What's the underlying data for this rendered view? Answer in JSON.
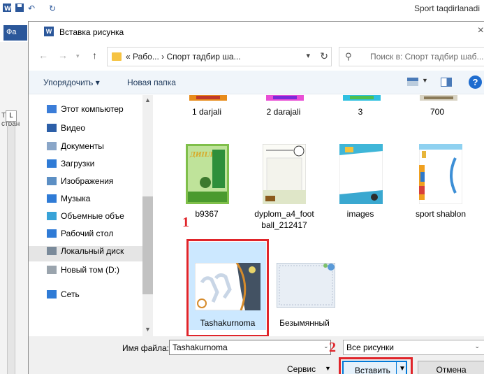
{
  "word": {
    "title": "Sport taqdirlanadi",
    "file_tab": "Фа",
    "left_label": "Титу стран",
    "ruler_btn": "L"
  },
  "dialog": {
    "title": "Вставка рисунка",
    "close": "×",
    "app_icon": "W"
  },
  "address": {
    "path": "« Рабо... › Спорт тадбир ша...",
    "search_placeholder": "Поиск в: Спорт тадбир шаб..."
  },
  "toolbar": {
    "organize": "Упорядочить ▾",
    "new_folder": "Новая папка",
    "help": "?"
  },
  "nav": {
    "items": [
      {
        "label": "Этот компьютер",
        "icon": "computer-icon",
        "color": "#3b7dd8"
      },
      {
        "label": "Видео",
        "icon": "video-icon",
        "color": "#2c5fa8"
      },
      {
        "label": "Документы",
        "icon": "documents-icon",
        "color": "#8aa6c8"
      },
      {
        "label": "Загрузки",
        "icon": "downloads-icon",
        "color": "#2f7bd6"
      },
      {
        "label": "Изображения",
        "icon": "pictures-icon",
        "color": "#5c8fc4"
      },
      {
        "label": "Музыка",
        "icon": "music-icon",
        "color": "#2f7bd6"
      },
      {
        "label": "Объемные объе",
        "icon": "3d-objects-icon",
        "color": "#38a3d8"
      },
      {
        "label": "Рабочий стол",
        "icon": "desktop-icon",
        "color": "#2f7bd6"
      },
      {
        "label": "Локальный диск",
        "icon": "local-disk-icon",
        "color": "#7a8a9a"
      },
      {
        "label": "Новый том (D:)",
        "icon": "drive-icon",
        "color": "#9aa4ad"
      },
      {
        "label": "Сеть",
        "icon": "network-icon",
        "color": "#2f7bd6"
      }
    ]
  },
  "files": {
    "row1": [
      "1 darjali",
      "2 darajali",
      "3",
      "700"
    ],
    "row2": [
      "b9367",
      "dyplom_a4_foot ball_212417",
      "images",
      "sport shablon"
    ],
    "row3": [
      "Tashakurnoma",
      "Безымянный"
    ]
  },
  "annotations": {
    "num1": "1",
    "num2": "2"
  },
  "bottom": {
    "filename_label": "Имя файла:",
    "filename_value": "Tashakurnoma",
    "filter": "Все рисунки",
    "service": "Сервис",
    "insert": "Вставить",
    "cancel": "Отмена"
  },
  "colors": {
    "accent": "#0078d7",
    "annotation_red": "#e0242a",
    "selection": "#cce8ff"
  }
}
